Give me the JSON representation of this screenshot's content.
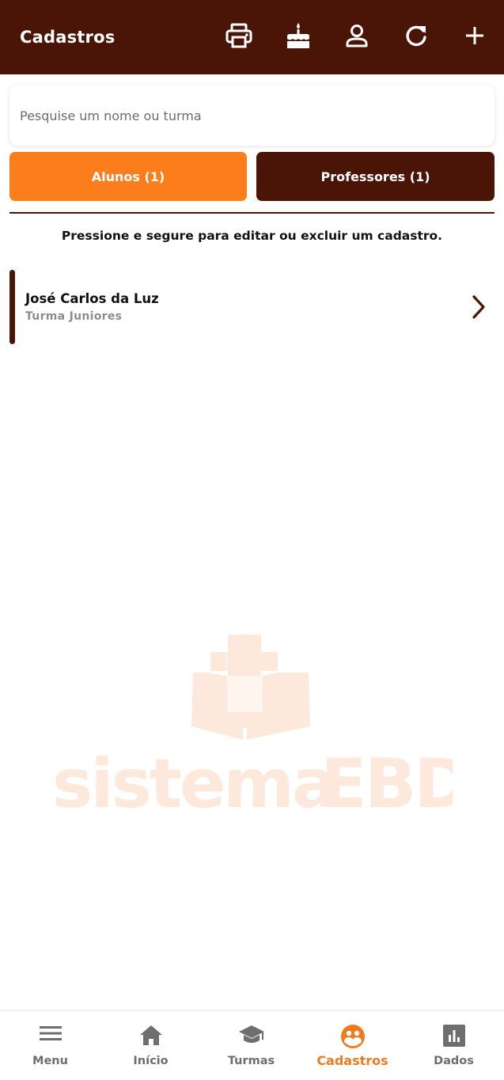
{
  "header": {
    "title": "Cadastros",
    "actions": [
      {
        "name": "print-icon"
      },
      {
        "name": "birthday-cake-icon"
      },
      {
        "name": "person-icon"
      },
      {
        "name": "refresh-icon"
      },
      {
        "name": "plus-icon"
      }
    ]
  },
  "search": {
    "placeholder": "Pesquise um nome ou turma",
    "value": ""
  },
  "tabs": {
    "alunos": "Alunos (1)",
    "professores": "Professores (1)"
  },
  "hint": "Pressione e segure para editar ou excluir um cadastro.",
  "list": [
    {
      "name": "José Carlos da Luz",
      "subtitle": "Turma Juniores"
    }
  ],
  "watermark": {
    "text_light": "sistema",
    "text_bold": "EBD"
  },
  "bottom_nav": [
    {
      "label": "Menu",
      "icon": "menu-icon"
    },
    {
      "label": "Início",
      "icon": "home-icon"
    },
    {
      "label": "Turmas",
      "icon": "graduation-cap-icon"
    },
    {
      "label": "Cadastros",
      "icon": "people-icon",
      "active": true
    },
    {
      "label": "Dados",
      "icon": "bar-chart-icon"
    }
  ],
  "colors": {
    "brand_dark": "#4a1406",
    "accent": "#fb7d1c",
    "active_nav": "#f07b1f",
    "watermark": "#fde9dc"
  }
}
